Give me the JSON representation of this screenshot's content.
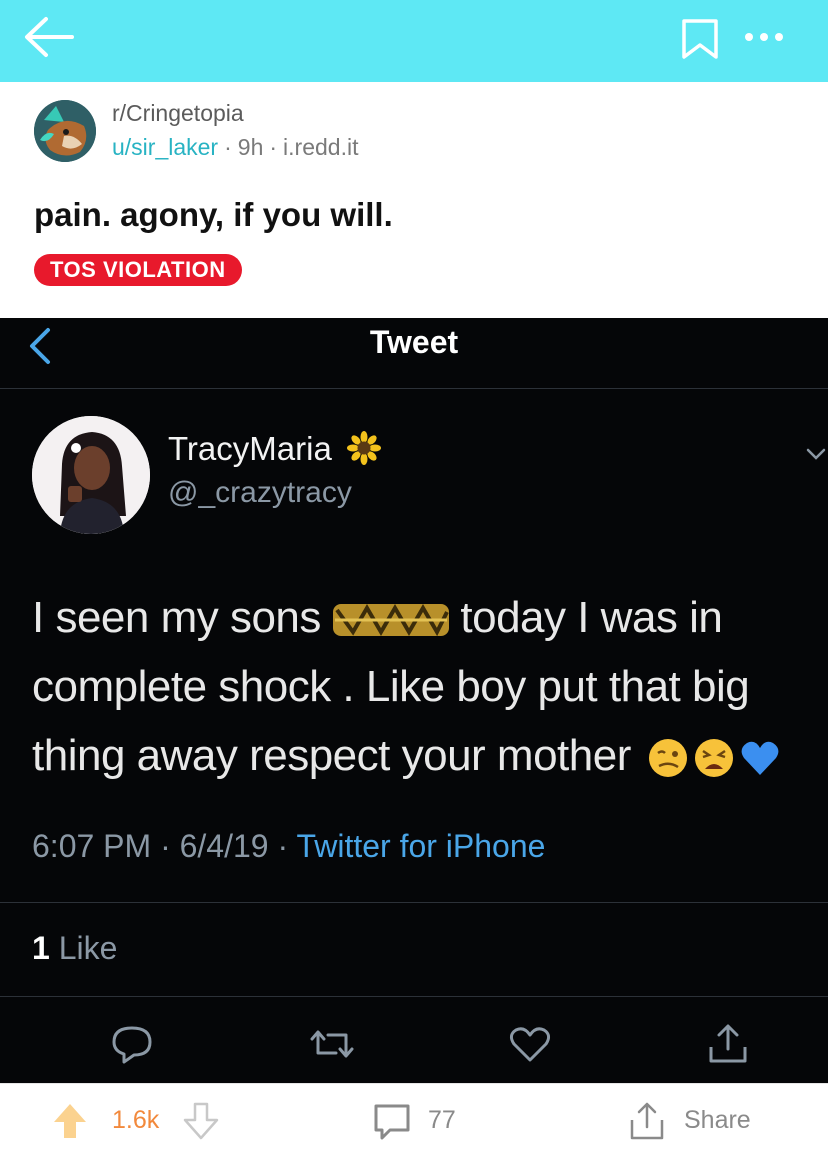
{
  "topbar": {
    "back_icon": "arrow-left-icon",
    "bookmark_icon": "bookmark-icon",
    "more_icon": "more-horizontal-icon",
    "color": "#5ee8f4"
  },
  "post": {
    "subreddit": "r/Cringetopia",
    "user": "u/sir_laker",
    "age": "9h",
    "domain": "i.redd.it",
    "title": "pain. agony, if you will.",
    "flair": "TOS VIOLATION",
    "flair_color": "#e8192c"
  },
  "tweet": {
    "header": "Tweet",
    "name": "TracyMaria",
    "name_emoji": "sunflower-icon",
    "handle": "@_crazytracy",
    "text_part1": "I seen my sons",
    "text_part2": "today I was in complete shock . Like boy put that big thing away respect your mother",
    "emojis": [
      "woozy-face-icon",
      "tired-face-icon",
      "blue-heart-icon"
    ],
    "time": "6:07 PM · 6/4/19 · ",
    "source": "Twitter for iPhone",
    "like_count": "1",
    "like_label": " Like",
    "actions": [
      "reply-icon",
      "retweet-icon",
      "like-icon",
      "share-icon"
    ]
  },
  "bottombar": {
    "votes": "1.6k",
    "comments": "77",
    "share": "Share",
    "upvote_color": "#f2893c"
  }
}
